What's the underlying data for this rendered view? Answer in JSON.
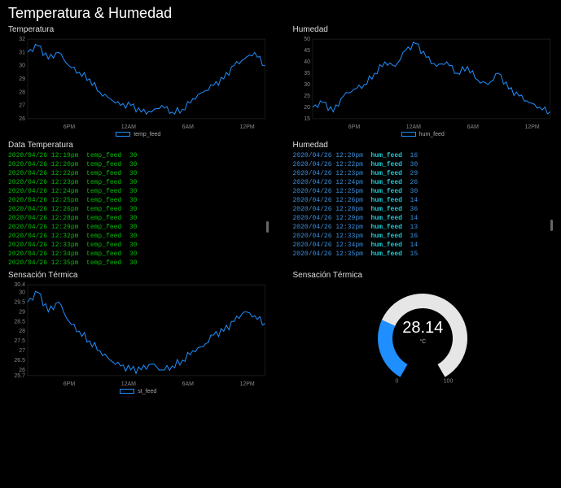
{
  "page_title": "Temperatura & Humedad",
  "panels": {
    "temp_chart": {
      "title": "Temperatura",
      "legend": "temp_feed"
    },
    "hum_chart": {
      "title": "Humedad",
      "legend": "hum_feed"
    },
    "temp_log": {
      "title": "Data Temperatura"
    },
    "hum_log": {
      "title": "Humedad"
    },
    "st_chart": {
      "title": "Sensación Térmica",
      "legend": "st_feed"
    },
    "gauge": {
      "title": "Sensación Térmica",
      "value": "28.14",
      "unit": "°C",
      "min": "0",
      "max": "100"
    }
  },
  "x_ticks": [
    "6PM",
    "12AM",
    "6AM",
    "12PM"
  ],
  "temp_log_rows": [
    {
      "dt": "2020/04/26 12:19pm",
      "feed": "temp_feed",
      "val": "30"
    },
    {
      "dt": "2020/04/26 12:20pm",
      "feed": "temp_feed",
      "val": "30"
    },
    {
      "dt": "2020/04/26 12:22pm",
      "feed": "temp_feed",
      "val": "30"
    },
    {
      "dt": "2020/04/26 12:23pm",
      "feed": "temp_feed",
      "val": "30"
    },
    {
      "dt": "2020/04/26 12:24pm",
      "feed": "temp_feed",
      "val": "30"
    },
    {
      "dt": "2020/04/26 12:25pm",
      "feed": "temp_feed",
      "val": "30"
    },
    {
      "dt": "2020/04/26 12:26pm",
      "feed": "temp_feed",
      "val": "30"
    },
    {
      "dt": "2020/04/26 12:28pm",
      "feed": "temp_feed",
      "val": "30"
    },
    {
      "dt": "2020/04/26 12:29pm",
      "feed": "temp_feed",
      "val": "30"
    },
    {
      "dt": "2020/04/26 12:32pm",
      "feed": "temp_feed",
      "val": "30"
    },
    {
      "dt": "2020/04/26 12:33pm",
      "feed": "temp_feed",
      "val": "30"
    },
    {
      "dt": "2020/04/26 12:34pm",
      "feed": "temp_feed",
      "val": "30"
    },
    {
      "dt": "2020/04/26 12:35pm",
      "feed": "temp_feed",
      "val": "30"
    }
  ],
  "hum_log_rows": [
    {
      "dt": "2020/04/26 12:20pm",
      "feed": "hum_feed",
      "val": "16"
    },
    {
      "dt": "2020/04/26 12:22pm",
      "feed": "hum_feed",
      "val": "30"
    },
    {
      "dt": "2020/04/26 12:23pm",
      "feed": "hum_feed",
      "val": "29"
    },
    {
      "dt": "2020/04/26 12:24pm",
      "feed": "hum_feed",
      "val": "26"
    },
    {
      "dt": "2020/04/26 12:25pm",
      "feed": "hum_feed",
      "val": "30"
    },
    {
      "dt": "2020/04/26 12:26pm",
      "feed": "hum_feed",
      "val": "14"
    },
    {
      "dt": "2020/04/26 12:28pm",
      "feed": "hum_feed",
      "val": "36"
    },
    {
      "dt": "2020/04/26 12:29pm",
      "feed": "hum_feed",
      "val": "14"
    },
    {
      "dt": "2020/04/26 12:32pm",
      "feed": "hum_feed",
      "val": "13"
    },
    {
      "dt": "2020/04/26 12:33pm",
      "feed": "hum_feed",
      "val": "16"
    },
    {
      "dt": "2020/04/26 12:34pm",
      "feed": "hum_feed",
      "val": "14"
    },
    {
      "dt": "2020/04/26 12:35pm",
      "feed": "hum_feed",
      "val": "15"
    }
  ],
  "chart_data": [
    {
      "id": "temp",
      "type": "line",
      "title": "Temperatura",
      "xlabel": "",
      "ylabel": "",
      "x_ticks": [
        "6PM",
        "12AM",
        "6AM",
        "12PM"
      ],
      "ylim": [
        26,
        32
      ],
      "y_ticks": [
        26,
        27,
        28,
        29,
        30,
        31,
        32
      ],
      "series": [
        {
          "name": "temp_feed",
          "x": [
            0,
            1,
            2,
            3,
            4,
            5,
            6,
            7,
            8,
            9,
            10,
            11,
            12,
            13,
            14,
            15,
            16,
            17,
            18,
            19,
            20,
            21,
            22,
            23
          ],
          "values": [
            31,
            31.5,
            30.5,
            31,
            30,
            29.5,
            29,
            28,
            27.5,
            27,
            27,
            26.5,
            26.5,
            27,
            26.5,
            26.7,
            27.5,
            28,
            28.5,
            29,
            30,
            30.5,
            31,
            30
          ]
        }
      ]
    },
    {
      "id": "hum",
      "type": "line",
      "title": "Humedad",
      "xlabel": "",
      "ylabel": "",
      "x_ticks": [
        "6PM",
        "12AM",
        "6AM",
        "12PM"
      ],
      "ylim": [
        15,
        50
      ],
      "y_ticks": [
        15,
        20,
        25,
        30,
        35,
        40,
        45,
        50
      ],
      "series": [
        {
          "name": "hum_feed",
          "x": [
            0,
            1,
            2,
            3,
            4,
            5,
            6,
            7,
            8,
            9,
            10,
            11,
            12,
            13,
            14,
            15,
            16,
            17,
            18,
            19,
            20,
            21,
            22,
            23
          ],
          "values": [
            20,
            22,
            18,
            25,
            28,
            30,
            35,
            40,
            38,
            45,
            48,
            42,
            38,
            40,
            35,
            38,
            32,
            30,
            35,
            28,
            25,
            22,
            20,
            18
          ]
        }
      ]
    },
    {
      "id": "st",
      "type": "line",
      "title": "Sensación Térmica",
      "xlabel": "",
      "ylabel": "",
      "x_ticks": [
        "6PM",
        "12AM",
        "6AM",
        "12PM"
      ],
      "ylim": [
        25.7,
        30.4
      ],
      "y_ticks": [
        25.7,
        26.0,
        26.5,
        27.0,
        27.5,
        28.0,
        28.5,
        29.0,
        29.5,
        30.0,
        30.4
      ],
      "series": [
        {
          "name": "st_feed",
          "x": [
            0,
            1,
            2,
            3,
            4,
            5,
            6,
            7,
            8,
            9,
            10,
            11,
            12,
            13,
            14,
            15,
            16,
            17,
            18,
            19,
            20,
            21,
            22,
            23
          ],
          "values": [
            29.5,
            30.0,
            29.0,
            29.5,
            28.5,
            28.0,
            27.5,
            27.0,
            26.5,
            26.2,
            26.0,
            26.0,
            26.3,
            26.0,
            26.2,
            26.5,
            27.0,
            27.2,
            27.8,
            28.0,
            28.5,
            29.0,
            28.8,
            28.4
          ]
        }
      ]
    },
    {
      "id": "gauge",
      "type": "gauge",
      "title": "Sensación Térmica",
      "value": 28.14,
      "min": 0,
      "max": 100,
      "unit": "°C"
    }
  ]
}
